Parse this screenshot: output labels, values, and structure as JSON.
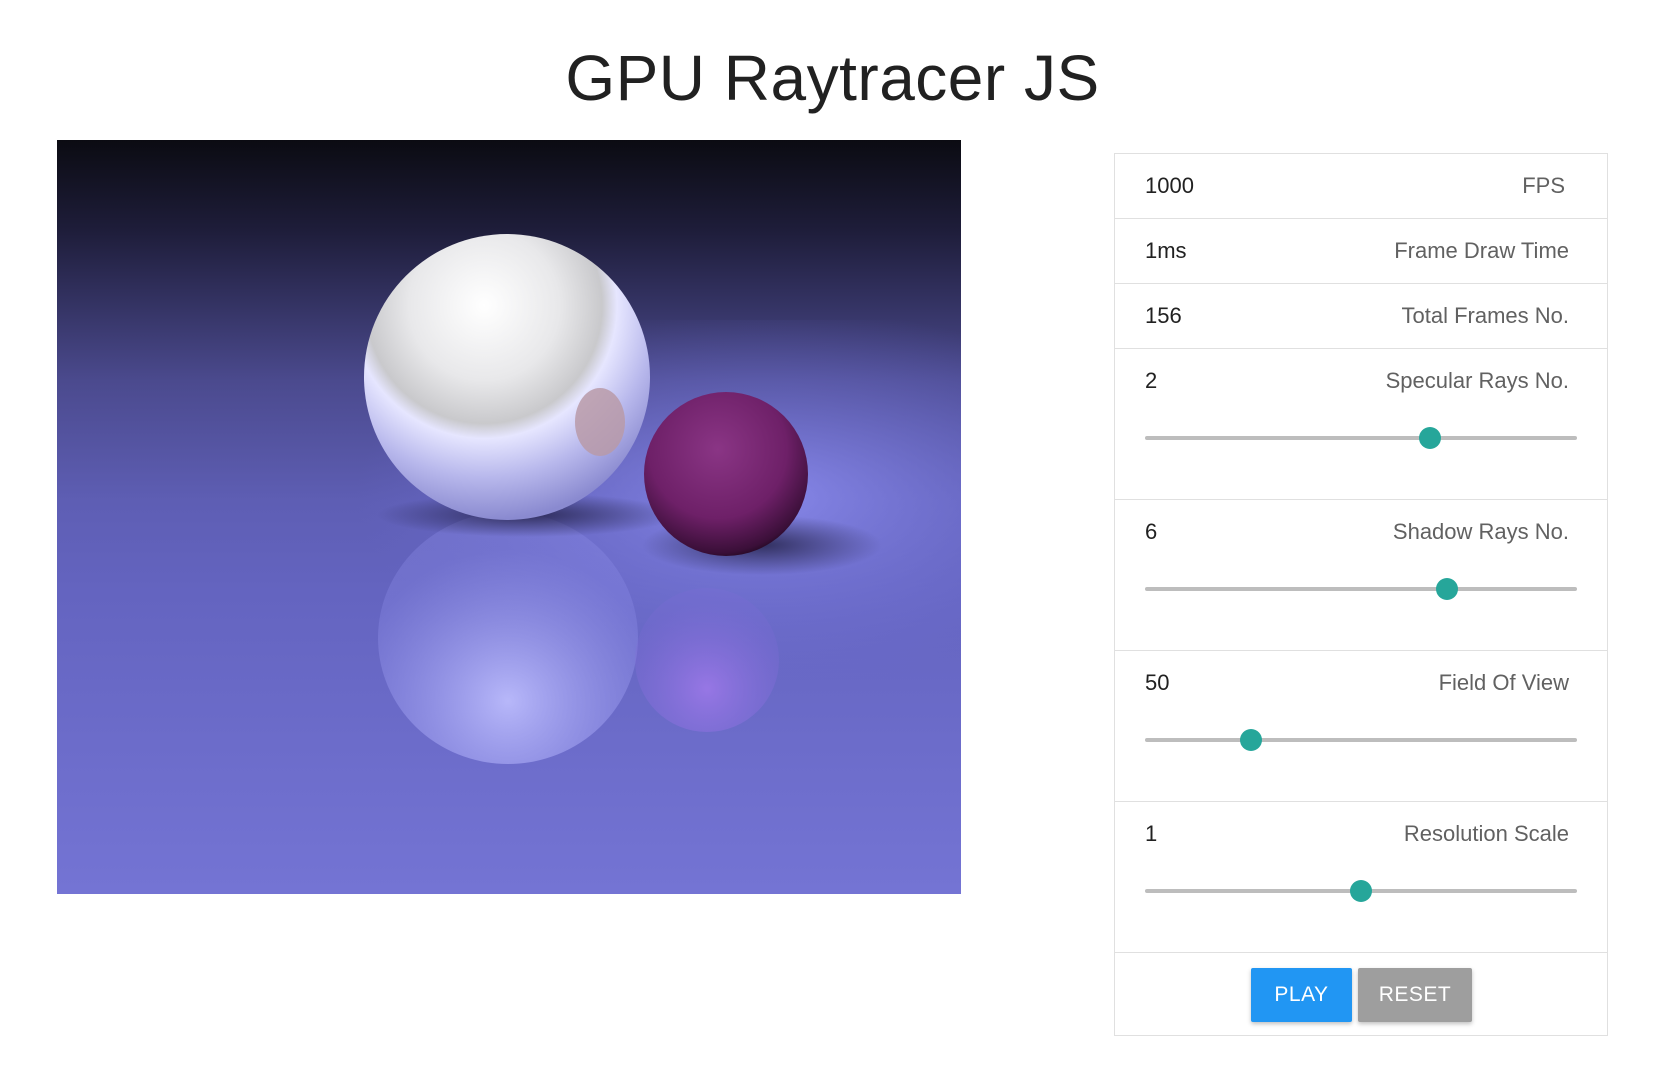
{
  "page": {
    "title": "GPU Raytracer JS"
  },
  "stats": [
    {
      "value": "1000",
      "label": "FPS"
    },
    {
      "value": "1ms",
      "label": "Frame Draw Time"
    },
    {
      "value": "156",
      "label": "Total Frames No."
    }
  ],
  "sliders": [
    {
      "value": "2",
      "label": "Specular Rays No.",
      "level": 0.66
    },
    {
      "value": "6",
      "label": "Shadow Rays No.",
      "level": 0.7
    },
    {
      "value": "50",
      "label": "Field Of View",
      "level": 0.245
    },
    {
      "value": "1",
      "label": "Resolution Scale",
      "level": 0.5
    }
  ],
  "buttons": {
    "play_label": "PLAY",
    "reset_label": "RESET"
  },
  "colors": {
    "accent": "#26a69a",
    "play": "#2196f3",
    "reset": "#9e9e9e",
    "floor": "#6f6fd0",
    "sky": "#0b0b14"
  }
}
